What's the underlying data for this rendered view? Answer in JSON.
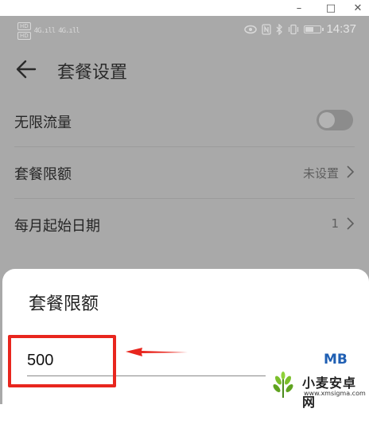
{
  "window": {
    "minimize_glyph": "–",
    "maximize_glyph": "□",
    "close_glyph": "✕"
  },
  "status_bar": {
    "sim1": "HD",
    "sim2": "HD",
    "signal1": "4G.ıll",
    "signal2": "4G.ıll",
    "time": "14:37",
    "battery_level": 0.55,
    "icons": [
      "eye-icon",
      "nfc-icon",
      "bluetooth-icon",
      "vibrate-icon",
      "battery-icon"
    ]
  },
  "appbar": {
    "back_icon": "arrow-left-icon",
    "title": "套餐设置"
  },
  "settings": {
    "unlimited_data": {
      "label": "无限流量",
      "enabled": false
    },
    "plan_limit": {
      "label": "套餐限额",
      "value": "未设置"
    },
    "monthly_start_date": {
      "label": "每月起始日期",
      "value": "1"
    }
  },
  "dialog": {
    "title": "套餐限额",
    "amount_value": "500",
    "unit": "MB"
  },
  "annotation": {
    "color": "#e8261e"
  },
  "watermark": {
    "name": "小麦安卓网",
    "url": "www.xmsigma.com"
  }
}
